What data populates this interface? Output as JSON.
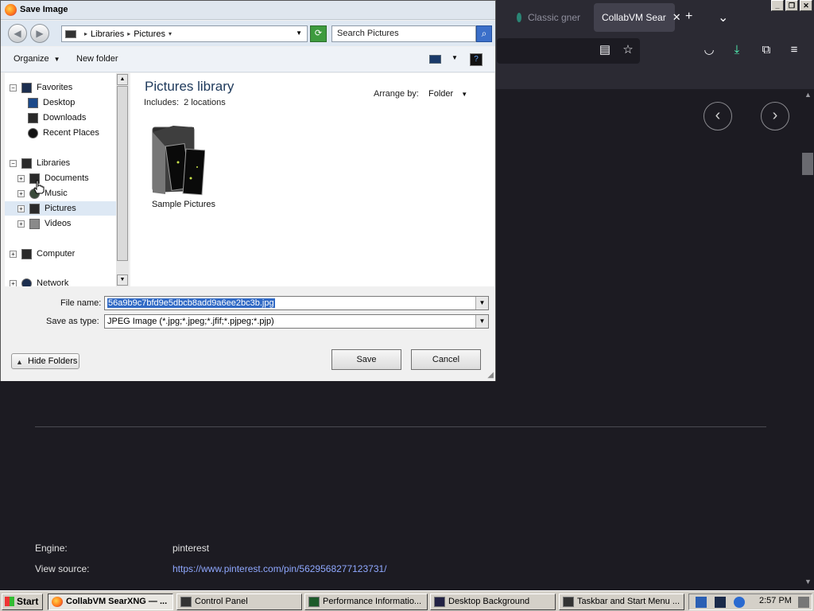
{
  "browser": {
    "tabs": [
      {
        "label": "Classic gner",
        "active": false
      },
      {
        "label": "CollabVM Sear",
        "active": true
      }
    ],
    "new_tab": "+",
    "list_tabs": "⌄",
    "page": {
      "prev": "‹",
      "next": "›",
      "engine_label": "Engine:",
      "engine_value": "pinterest",
      "source_label": "View source:",
      "source_value": "https://www.pinterest.com/pin/5629568277123731/"
    }
  },
  "dialog": {
    "title": "Save Image",
    "address": {
      "root": "Libraries",
      "current": "Pictures"
    },
    "search_placeholder": "Search Pictures",
    "toolbar": {
      "organize": "Organize",
      "new_folder": "New folder"
    },
    "nav": [
      {
        "label": "Favorites",
        "icon": "star-icon",
        "level": 0,
        "expander": "−"
      },
      {
        "label": "Desktop",
        "icon": "desktop-icon",
        "level": 1,
        "expander": ""
      },
      {
        "label": "Downloads",
        "icon": "downloads-icon",
        "level": 1,
        "expander": ""
      },
      {
        "label": "Recent Places",
        "icon": "recent-places-icon",
        "level": 1,
        "expander": ""
      },
      {
        "label": "Libraries",
        "icon": "libraries-icon",
        "level": 0,
        "expander": "−"
      },
      {
        "label": "Documents",
        "icon": "documents-icon",
        "level": 1,
        "expander": "+"
      },
      {
        "label": "Music",
        "icon": "music-icon",
        "level": 1,
        "expander": "+"
      },
      {
        "label": "Pictures",
        "icon": "pictures-icon",
        "level": 1,
        "expander": "+",
        "selected": true
      },
      {
        "label": "Videos",
        "icon": "videos-icon",
        "level": 1,
        "expander": "+"
      },
      {
        "label": "Computer",
        "icon": "computer-icon",
        "level": 0,
        "expander": "+"
      },
      {
        "label": "Network",
        "icon": "network-icon",
        "level": 0,
        "expander": "+"
      }
    ],
    "content": {
      "title": "Pictures library",
      "includes_label": "Includes:",
      "includes_value": "2 locations",
      "arrange_label": "Arrange by:",
      "arrange_value": "Folder",
      "items": [
        {
          "label": "Sample Pictures"
        }
      ]
    },
    "file_name_label": "File name:",
    "file_name": "56a9b9c7bfd9e5dbcb8add9a6ee2bc3b.jpg",
    "save_type_label": "Save as type:",
    "save_type": "JPEG Image (*.jpg;*.jpeg;*.jfif;*.pjpeg;*.pjp)",
    "save_button": "Save",
    "cancel_button": "Cancel",
    "hide_folders": "Hide Folders"
  },
  "taskbar": {
    "start": "Start",
    "tasks": [
      {
        "label": "CollabVM SearXNG — ...",
        "active": true,
        "icon": "firefox-icon"
      },
      {
        "label": "Control Panel",
        "active": false,
        "icon": "control-panel-icon"
      },
      {
        "label": "Performance Informatio...",
        "active": false,
        "icon": "performance-icon"
      },
      {
        "label": "Desktop Background",
        "active": false,
        "icon": "desktop-background-icon"
      },
      {
        "label": "Taskbar and Start Menu ...",
        "active": false,
        "icon": "taskbar-settings-icon"
      }
    ],
    "clock": "2:57 PM"
  },
  "colors": {
    "browser_bg": "#1c1b22",
    "link": "#8fa8ff",
    "selection": "#316ac5",
    "library_title": "#1e395b"
  }
}
